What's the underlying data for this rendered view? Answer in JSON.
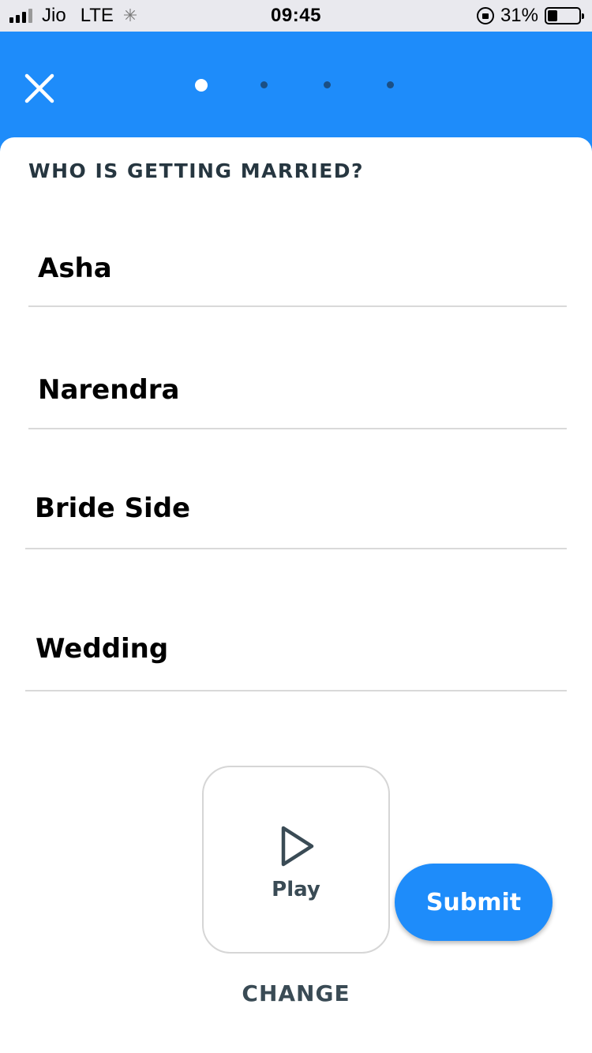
{
  "status_bar": {
    "carrier": "Jio",
    "network": "LTE",
    "time": "09:45",
    "battery_percent": "31%",
    "battery_level": 0.31
  },
  "header": {
    "close_icon": "close-icon",
    "steps_total": 4,
    "current_step": 1
  },
  "form": {
    "question": "WHO IS GETTING MARRIED?",
    "fields": [
      {
        "value": "Asha"
      },
      {
        "value": "Narendra"
      },
      {
        "value": "Bride Side"
      },
      {
        "value": "Wedding"
      }
    ]
  },
  "actions": {
    "play_label": "Play",
    "submit_label": "Submit",
    "change_label": "CHANGE"
  },
  "colors": {
    "primary": "#1e8cfa",
    "text_dark": "#263640",
    "divider": "#d9d9d9"
  }
}
